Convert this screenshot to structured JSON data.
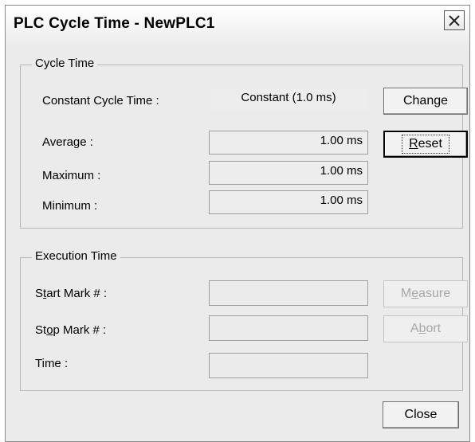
{
  "window": {
    "title": "PLC Cycle Time - NewPLC1",
    "close_glyph": "✕"
  },
  "cycle_time": {
    "legend": "Cycle Time",
    "constant_label": "Constant Cycle Time :",
    "constant_value": "Constant (1.0 ms)",
    "change_button": "Change",
    "average_label": "Average :",
    "average_value": "1.00 ms",
    "maximum_label": "Maximum :",
    "maximum_value": "1.00 ms",
    "minimum_label": "Minimum :",
    "minimum_value": "1.00 ms",
    "reset_button": {
      "pre": "",
      "u": "R",
      "post": "eset"
    }
  },
  "execution_time": {
    "legend": "Execution Time",
    "start_label": {
      "pre": "S",
      "u": "t",
      "post": "art Mark # :"
    },
    "start_value": "",
    "stop_label": {
      "pre": "St",
      "u": "o",
      "post": "p Mark # :"
    },
    "stop_value": "",
    "time_label": "Time :",
    "time_value": "",
    "measure_button": {
      "pre": "M",
      "u": "e",
      "post": "asure"
    },
    "abort_button": {
      "pre": "A",
      "u": "b",
      "post": "ort"
    }
  },
  "footer": {
    "close_button": "Close"
  },
  "icons": {
    "close": "close-icon"
  }
}
